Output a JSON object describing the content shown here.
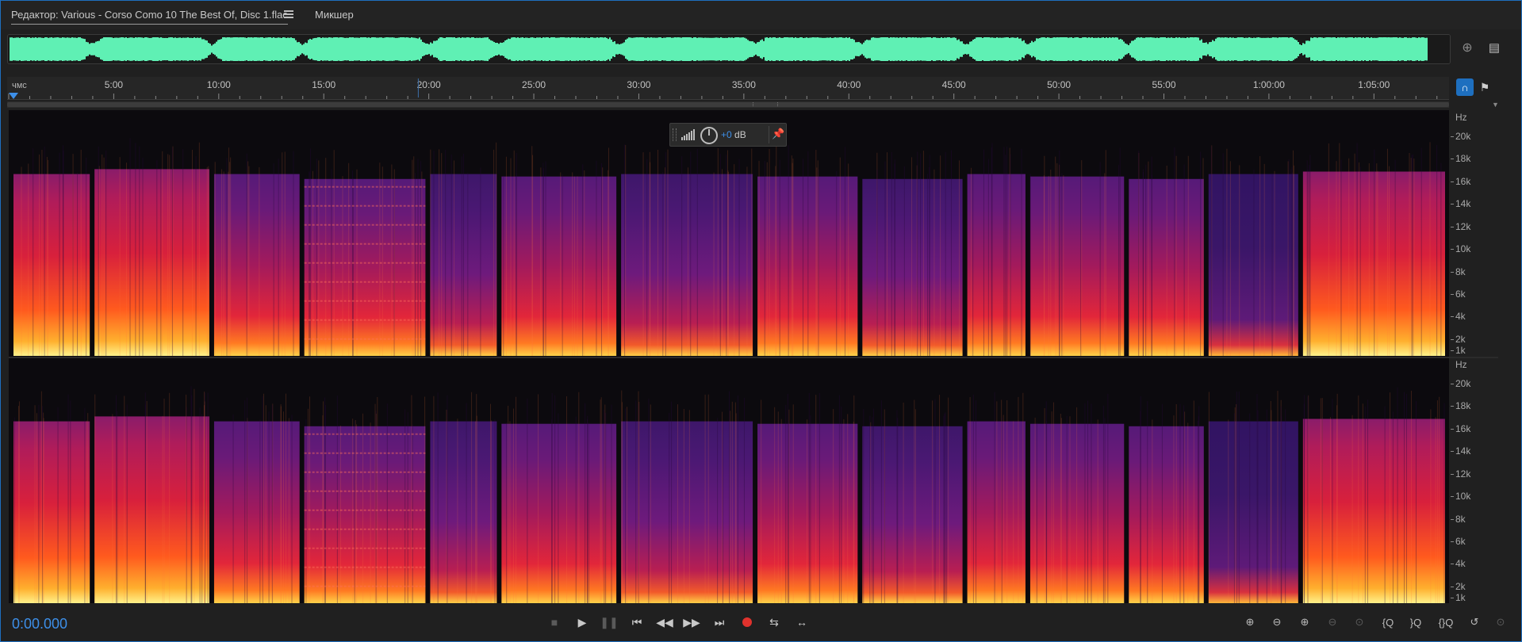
{
  "editor_tab": {
    "title": "Редактор: Various - Corso Como 10 The Best Of, Disc 1.flac",
    "menu_icon": "hamburger-icon"
  },
  "mixer_tab": {
    "label": "Микшер"
  },
  "ruler": {
    "start_label": "чмс",
    "labels": [
      "5:00",
      "10:00",
      "15:00",
      "20:00",
      "25:00",
      "30:00",
      "35:00",
      "40:00",
      "45:00",
      "50:00",
      "55:00",
      "1:00:00",
      "1:05:00"
    ],
    "total_minutes": 68.5
  },
  "track_boundaries_minutes": [
    3.9,
    9.6,
    13.9,
    19.9,
    23.3,
    29.0,
    35.5,
    40.5,
    45.5,
    48.5,
    53.2,
    57.0,
    61.5
  ],
  "freq_scale": {
    "unit": "Hz",
    "labels": [
      "20k",
      "18k",
      "16k",
      "14k",
      "12k",
      "10k",
      "8k",
      "6k",
      "4k",
      "2k",
      "1k"
    ]
  },
  "hud": {
    "gain_value": "+0",
    "gain_unit": "dB"
  },
  "transport": {
    "timecode": "0:00.000"
  },
  "colors": {
    "accent": "#1e6fbf",
    "waveform": "#5ff0b4",
    "timecode": "#3d8fe8",
    "record": "#e0322d"
  }
}
